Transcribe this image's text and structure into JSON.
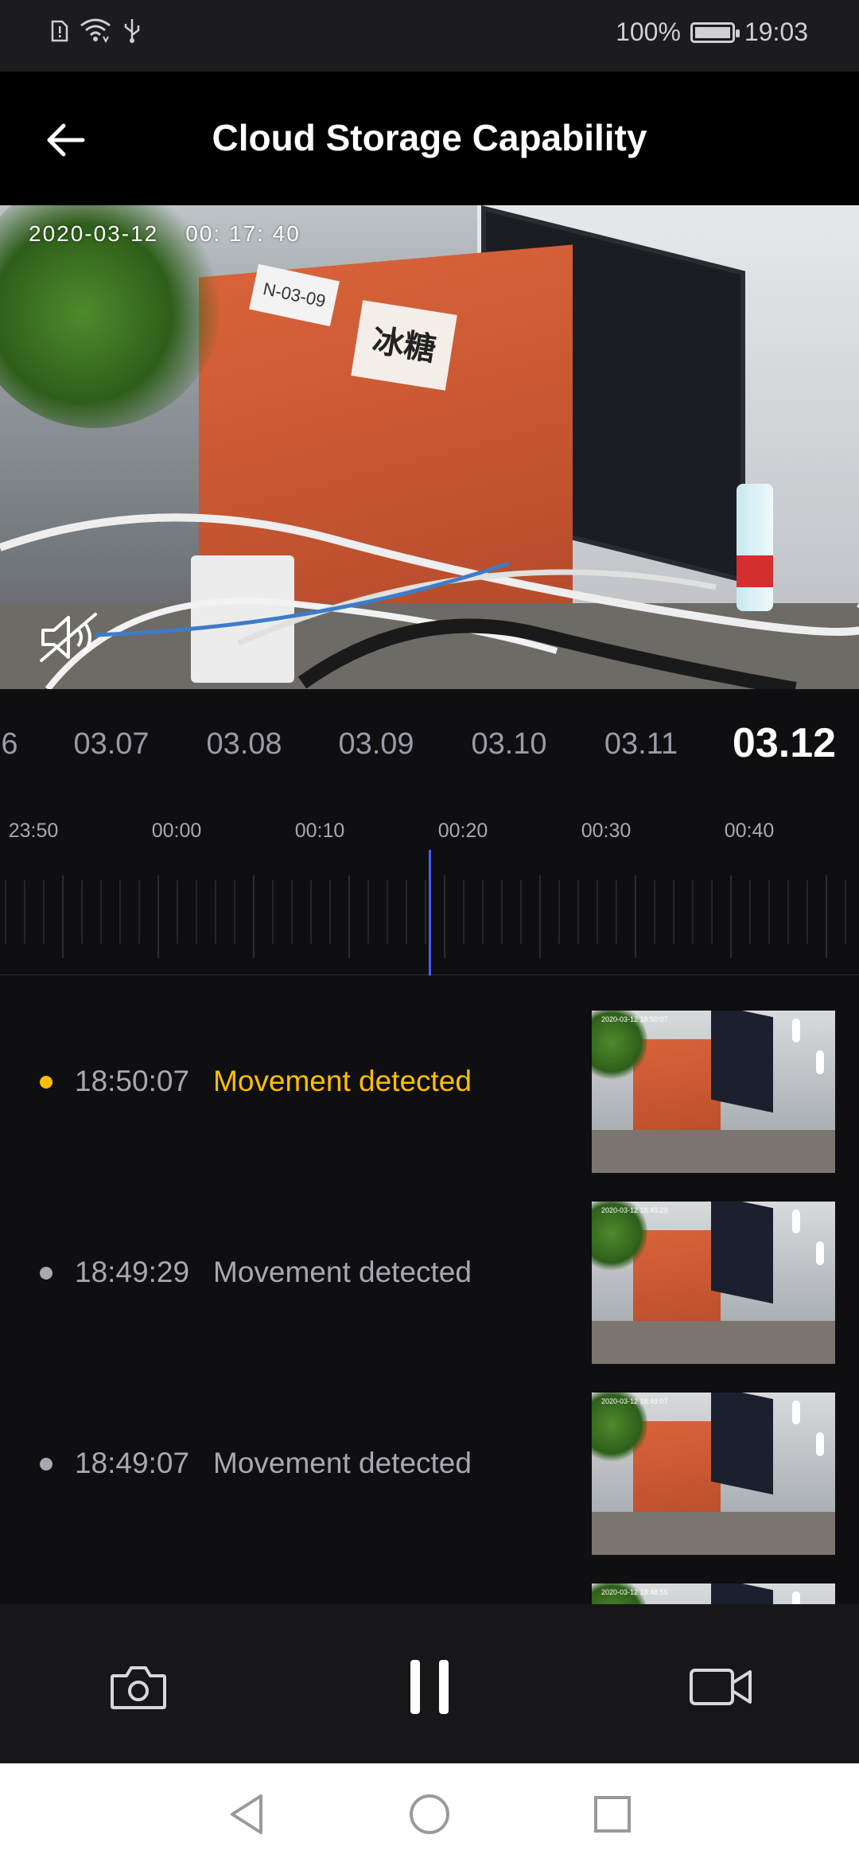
{
  "status_bar": {
    "battery_percent": "100%",
    "time": "19:03",
    "icons": [
      "sim-alert-icon",
      "wifi-icon",
      "usb-icon",
      "battery-charging-icon"
    ]
  },
  "header": {
    "title": "Cloud Storage Capability",
    "back_icon": "back-arrow-icon"
  },
  "video": {
    "date": "2020-03-12",
    "time": "00: 17: 40",
    "sign_text": "冰糖",
    "tag_text": "N-03-09",
    "mute_icon": "speaker-muted-icon"
  },
  "dates": {
    "items": [
      "6",
      "03.07",
      "03.08",
      "03.09",
      "03.10",
      "03.11",
      "03.12"
    ],
    "selected": "03.12"
  },
  "timeline": {
    "labels": [
      "23:50",
      "00:00",
      "00:10",
      "00:20",
      "00:30",
      "00:40"
    ],
    "playhead_color": "#4a5cff"
  },
  "events": [
    {
      "time": "18:50:07",
      "label": "Movement detected",
      "active": true,
      "thumb_stamp": "2020-03-12 18:50:07"
    },
    {
      "time": "18:49:29",
      "label": "Movement detected",
      "active": false,
      "thumb_stamp": "2020-03-12 18:49:29"
    },
    {
      "time": "18:49:07",
      "label": "Movement detected",
      "active": false,
      "thumb_stamp": "2020-03-12 18:49:07"
    },
    {
      "time": "",
      "label": "",
      "active": false,
      "thumb_stamp": "2020-03-12 18:48:55"
    }
  ],
  "controls": {
    "snapshot_icon": "camera-icon",
    "pause_icon": "pause-icon",
    "record_icon": "video-camera-icon"
  },
  "nav": {
    "back_icon": "nav-back-icon",
    "home_icon": "nav-home-icon",
    "recents_icon": "nav-recents-icon"
  },
  "colors": {
    "accent": "#ffbf00",
    "background": "#0f0f11",
    "inactive_text": "#a8a9b0"
  }
}
